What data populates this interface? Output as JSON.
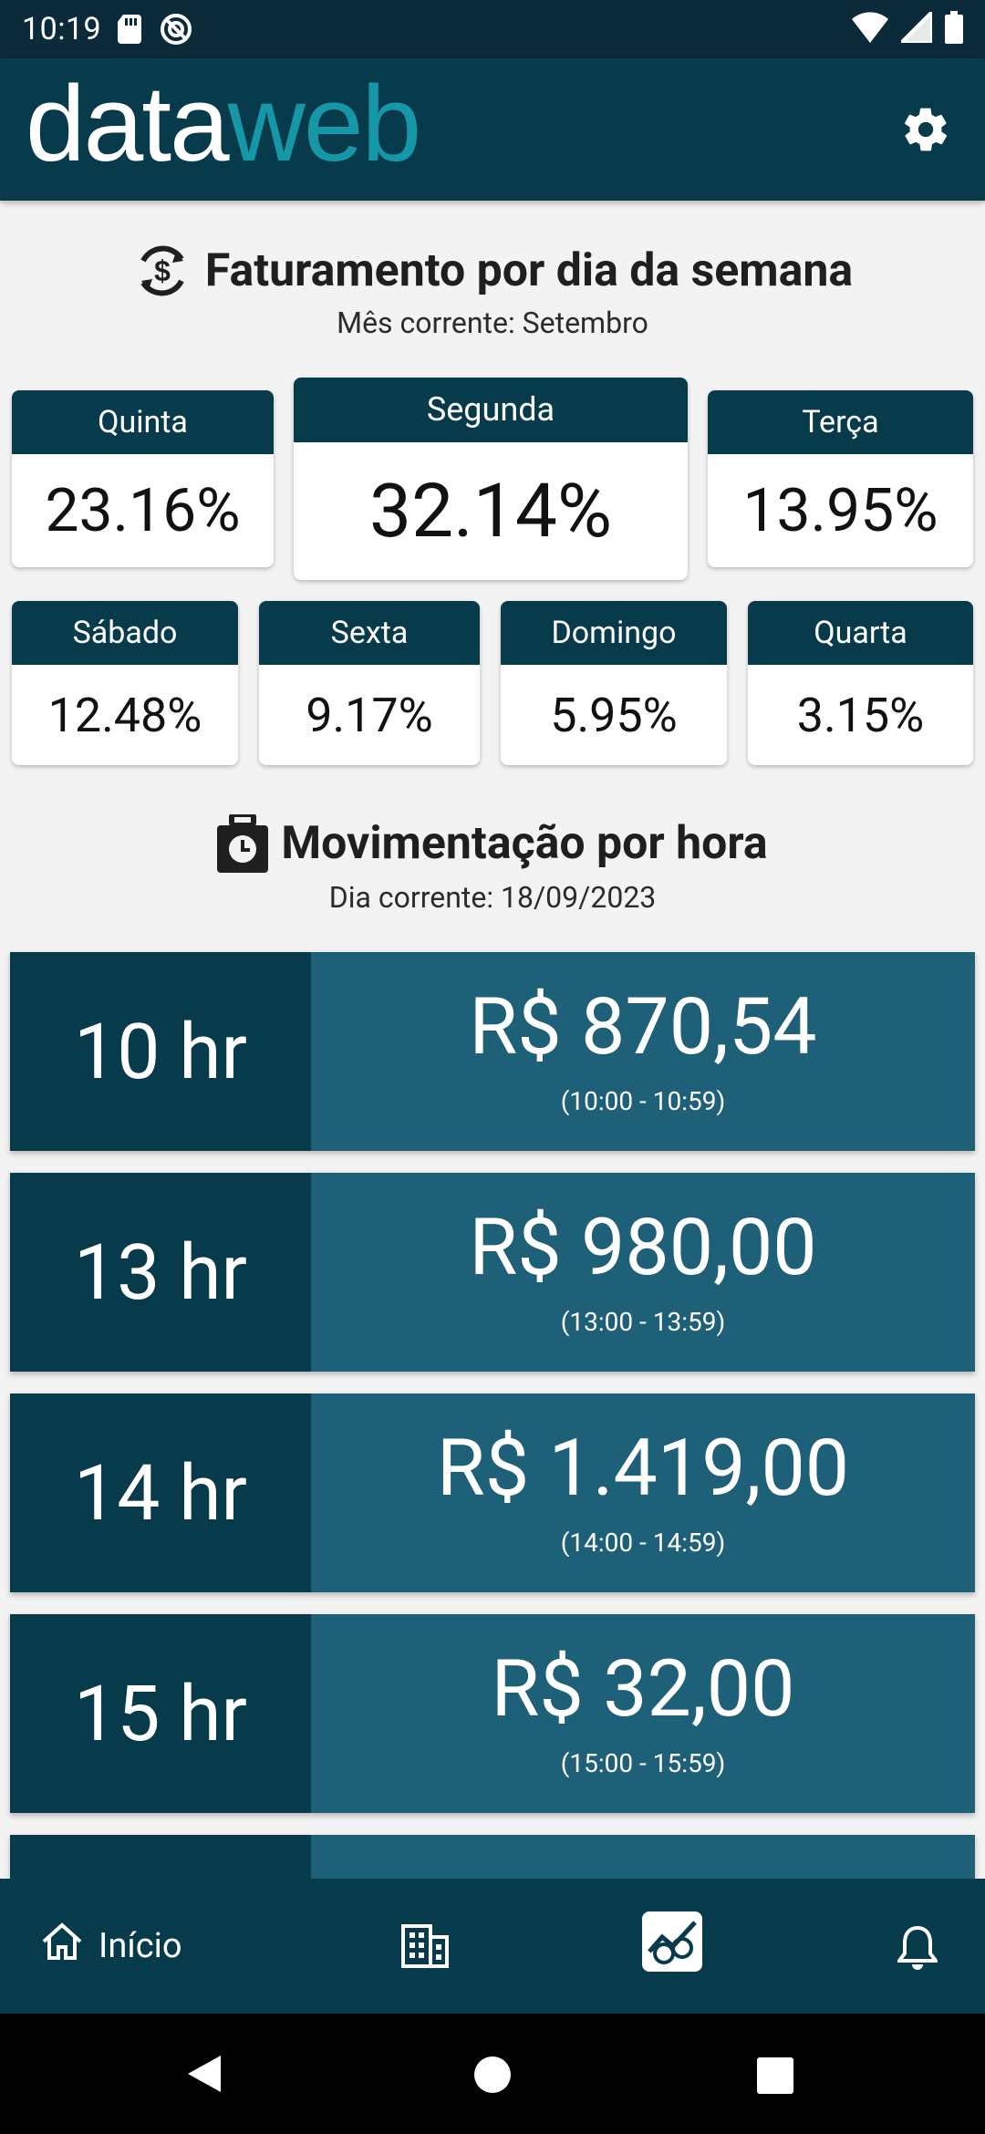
{
  "status_bar": {
    "time": "10:19"
  },
  "app": {
    "logo_data": "data",
    "logo_web": "web"
  },
  "weekday_section": {
    "title": "Faturamento por dia da semana",
    "subtitle": "Mês corrente: Setembro",
    "cards": [
      {
        "day": "Quinta",
        "value": "23.16%"
      },
      {
        "day": "Segunda",
        "value": "32.14%"
      },
      {
        "day": "Terça",
        "value": "13.95%"
      },
      {
        "day": "Sábado",
        "value": "12.48%"
      },
      {
        "day": "Sexta",
        "value": "9.17%"
      },
      {
        "day": "Domingo",
        "value": "5.95%"
      },
      {
        "day": "Quarta",
        "value": "3.15%"
      }
    ]
  },
  "hour_section": {
    "title": "Movimentação por hora",
    "subtitle": "Dia corrente: 18/09/2023",
    "rows": [
      {
        "hour": "10 hr",
        "amount": "R$ 870,54",
        "range": "(10:00 - 10:59)"
      },
      {
        "hour": "13 hr",
        "amount": "R$ 980,00",
        "range": "(13:00 - 13:59)"
      },
      {
        "hour": "14 hr",
        "amount": "R$ 1.419,00",
        "range": "(14:00 - 14:59)"
      },
      {
        "hour": "15 hr",
        "amount": "R$ 32,00",
        "range": "(15:00 - 15:59)"
      }
    ]
  },
  "bottom_nav": {
    "home_label": "Início"
  },
  "colors": {
    "primary": "#073b4c",
    "secondary": "#1e6078",
    "accent": "#1597a8",
    "logo_dot": "#f0a000"
  }
}
